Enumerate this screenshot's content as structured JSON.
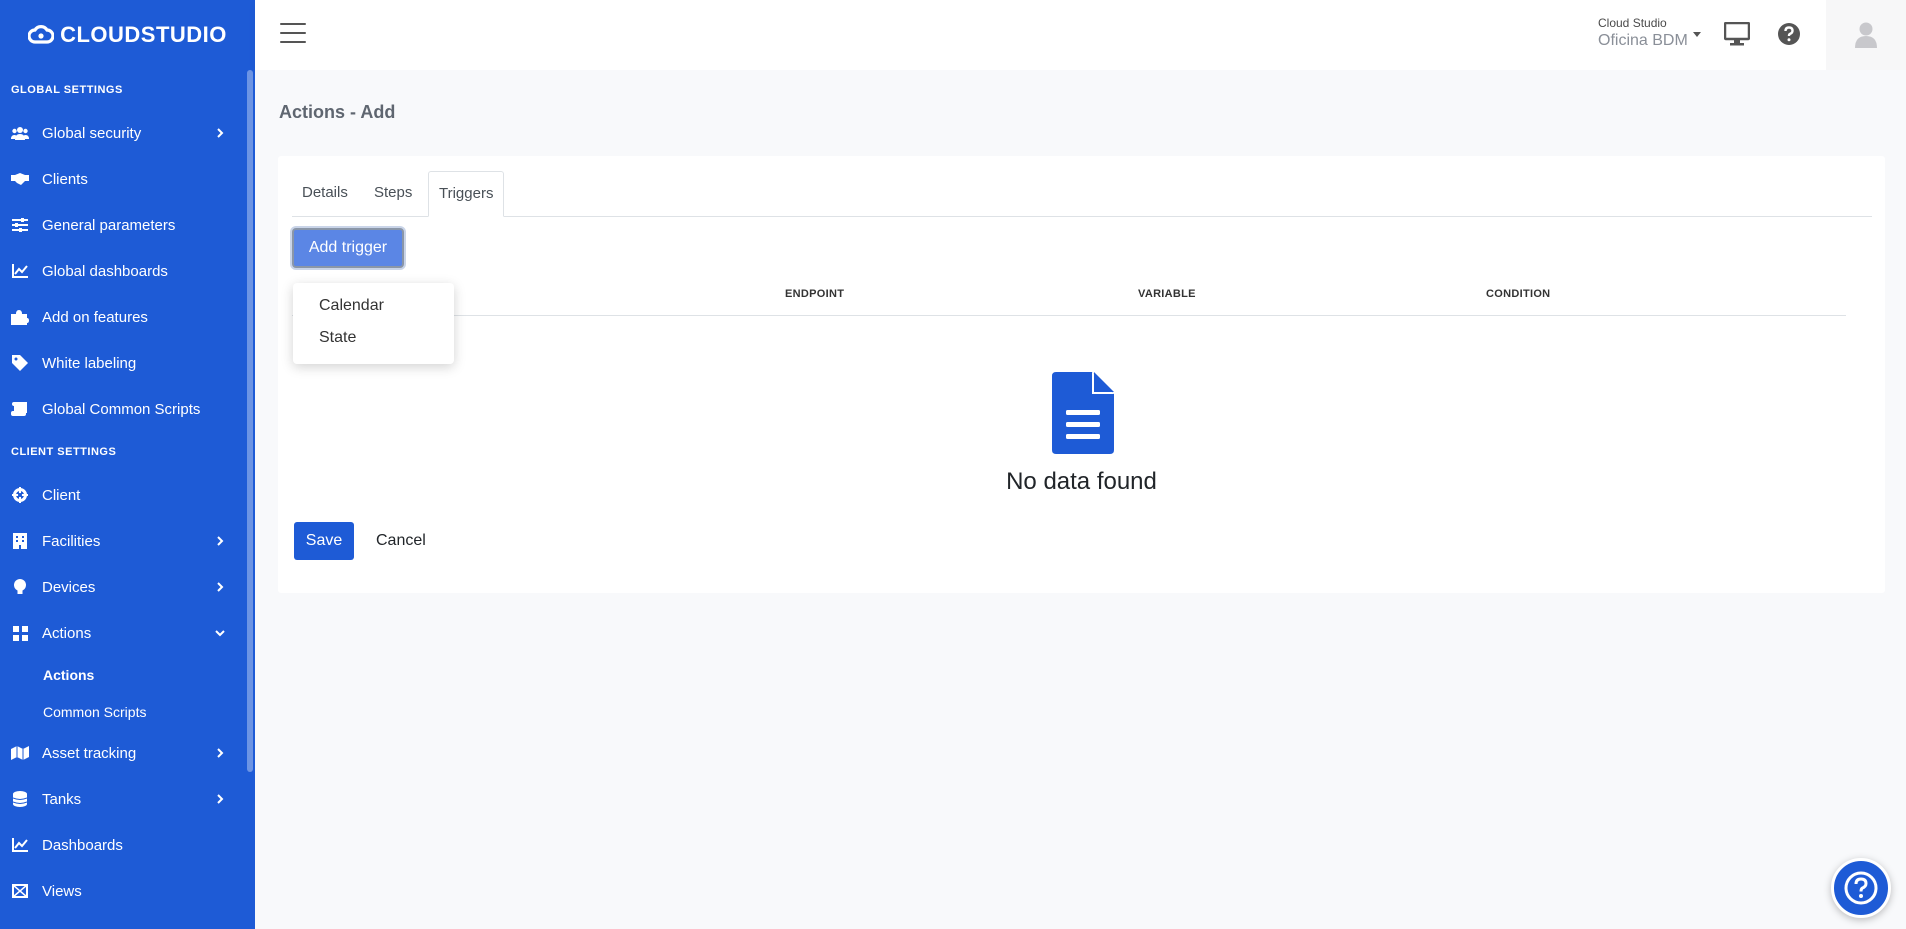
{
  "brand": {
    "name": "CLOUDSTUDIO"
  },
  "sidebar": {
    "global_title": "GLOBAL SETTINGS",
    "global_items": [
      {
        "label": "Global security",
        "icon": "users-icon"
      },
      {
        "label": "Clients",
        "icon": "handshake-icon"
      },
      {
        "label": "General parameters",
        "icon": "sliders-icon"
      },
      {
        "label": "Global dashboards",
        "icon": "chart-icon"
      },
      {
        "label": "Add on features",
        "icon": "puzzle-icon"
      },
      {
        "label": "White labeling",
        "icon": "tag-icon"
      },
      {
        "label": "Global Common Scripts",
        "icon": "scroll-icon"
      }
    ],
    "client_title": "CLIENT SETTINGS",
    "client_items": [
      {
        "label": "Client",
        "icon": "gear-icon"
      },
      {
        "label": "Facilities",
        "icon": "building-icon"
      },
      {
        "label": "Devices",
        "icon": "lightbulb-icon"
      },
      {
        "label": "Actions",
        "icon": "grid-icon"
      },
      {
        "label": "Actions"
      },
      {
        "label": "Common Scripts"
      },
      {
        "label": "Asset tracking",
        "icon": "map-icon"
      },
      {
        "label": "Tanks",
        "icon": "database-icon"
      },
      {
        "label": "Dashboards",
        "icon": "chart-icon"
      },
      {
        "label": "Views",
        "icon": "views-icon"
      }
    ]
  },
  "topbar": {
    "client_line1": "Cloud Studio",
    "client_line2": "Oficina BDM"
  },
  "page": {
    "title": "Actions - Add"
  },
  "tabs": [
    "Details",
    "Steps",
    "Triggers"
  ],
  "active_tab": "Triggers",
  "add_trigger_label": "Add trigger",
  "dropdown": [
    "Calendar",
    "State"
  ],
  "table_headers": [
    "ENDPOINT",
    "VARIABLE",
    "CONDITION"
  ],
  "empty_text": "No data found",
  "buttons": {
    "save": "Save",
    "cancel": "Cancel"
  },
  "colors": {
    "brand": "#1e5bd6",
    "add_trigger": "#5b86e5"
  }
}
